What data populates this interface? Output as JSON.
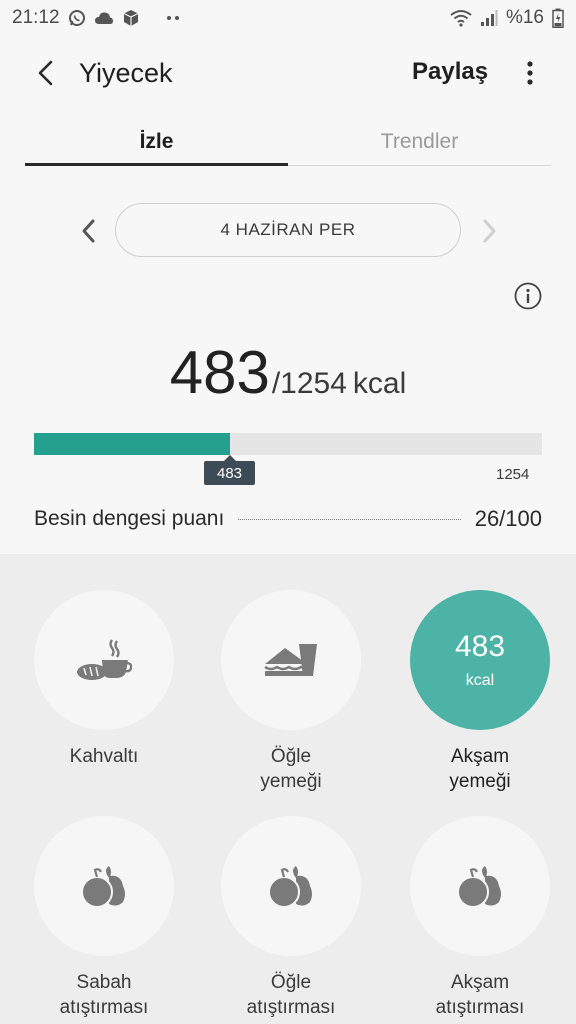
{
  "status": {
    "time": "21:12",
    "battery": "%16"
  },
  "appbar": {
    "title": "Yiyecek",
    "share_label": "Paylaş"
  },
  "tabs": [
    {
      "label": "İzle"
    },
    {
      "label": "Trendler"
    }
  ],
  "date": {
    "label": "4 HAZİRAN PER"
  },
  "calories": {
    "consumed": "483",
    "goal": "/1254",
    "unit": "kcal",
    "progress_fraction": 0.385,
    "marker_label": "483",
    "goal_label": "1254"
  },
  "balance": {
    "label": "Besin dengesi puanı",
    "score": "26/100"
  },
  "colors": {
    "accent": "#26a08e",
    "accent_circle": "#4db3a6",
    "marker": "#3d4b57"
  },
  "meals": [
    {
      "name": "Kahvaltı",
      "icon": "breakfast-icon"
    },
    {
      "name": "Öğle\nyemeği",
      "icon": "sandwich-icon"
    },
    {
      "name": "Akşam\nyemeği",
      "cal": "483",
      "unit": "kcal"
    },
    {
      "name": "Sabah\natıştırması",
      "icon": "fruit-icon"
    },
    {
      "name": "Öğle\natıştırması",
      "icon": "fruit-icon"
    },
    {
      "name": "Akşam\natıştırması",
      "icon": "fruit-icon"
    }
  ]
}
